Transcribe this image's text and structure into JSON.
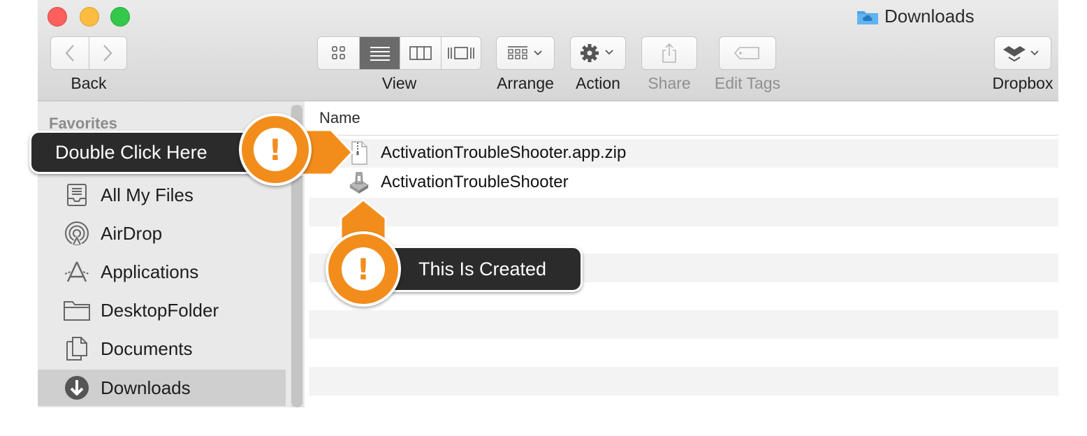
{
  "window": {
    "title": "Downloads"
  },
  "toolbar": {
    "back_label": "Back",
    "view_label": "View",
    "arrange_label": "Arrange",
    "action_label": "Action",
    "share_label": "Share",
    "edit_tags_label": "Edit Tags",
    "dropbox_label": "Dropbox",
    "selected_view": "list"
  },
  "sidebar": {
    "section_title": "Favorites",
    "items": [
      {
        "label": "All My Files",
        "icon": "all-files-icon"
      },
      {
        "label": "AirDrop",
        "icon": "airdrop-icon"
      },
      {
        "label": "Applications",
        "icon": "applications-icon"
      },
      {
        "label": "DesktopFolder",
        "icon": "folder-icon"
      },
      {
        "label": "Documents",
        "icon": "documents-icon"
      },
      {
        "label": "Downloads",
        "icon": "downloads-icon",
        "active": true
      }
    ]
  },
  "file_list": {
    "column_name": "Name",
    "files": [
      {
        "name": "ActivationTroubleShooter.app.zip",
        "icon": "zip-file-icon"
      },
      {
        "name": "ActivationTroubleShooter",
        "icon": "app-icon"
      }
    ]
  },
  "callouts": {
    "first": {
      "text": "Double Click Here",
      "mark": "!"
    },
    "second": {
      "text": "This Is Created",
      "mark": "!"
    }
  },
  "colors": {
    "callout_accent": "#f28d1c",
    "callout_bg": "#2b2b2b",
    "selected_sidebar": "#cfcfcf"
  }
}
